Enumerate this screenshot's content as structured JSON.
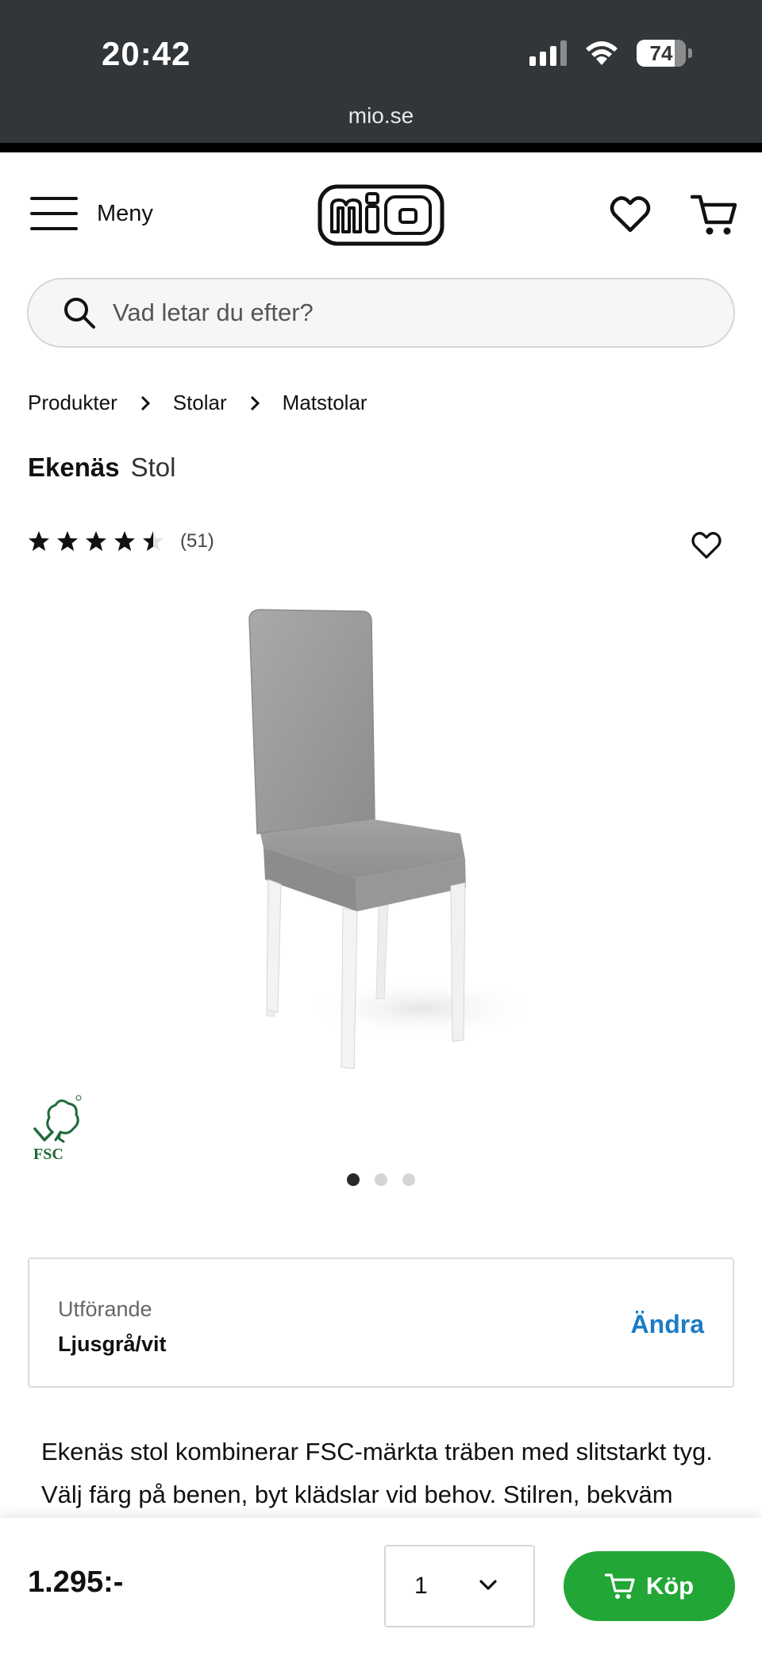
{
  "status_bar": {
    "time": "20:42",
    "battery": "74",
    "url": "mio.se"
  },
  "header": {
    "menu_label": "Meny",
    "logo_text": "mio"
  },
  "search": {
    "placeholder": "Vad letar du efter?"
  },
  "breadcrumb": [
    "Produkter",
    "Stolar",
    "Matstolar"
  ],
  "product": {
    "brand": "Ekenäs",
    "type": "Stol",
    "rating_value": 4.5,
    "rating_max": 5,
    "review_count": "(51)",
    "certification": "FSC",
    "image_count": 3,
    "active_image": 1
  },
  "variant": {
    "label": "Utförande",
    "value": "Ljusgrå/vit",
    "change_label": "Ändra"
  },
  "description": {
    "line1": "Ekenäs stol kombinerar FSC-märkta träben med slitstarkt tyg.",
    "line2": "Välj färg på benen, byt klädslar vid behov. Stilren, bekväm"
  },
  "buy_bar": {
    "price": "1.295:-",
    "quantity": "1",
    "buy_label": "Köp"
  },
  "colors": {
    "chrome_bg": "#333639",
    "link_blue": "#1c7cc4",
    "buy_green": "#22a636",
    "fsc_green": "#1f6a3a"
  }
}
